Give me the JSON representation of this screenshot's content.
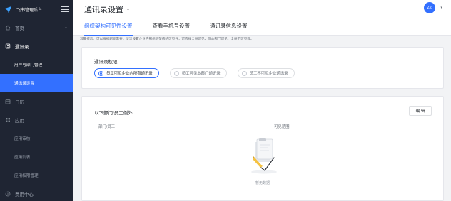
{
  "sidebar": {
    "brand_title": "飞书管理后台",
    "items": [
      {
        "label": "首页",
        "chevron": "▲"
      },
      {
        "label": "通讯录"
      },
      {
        "label": "用户与部门管理"
      },
      {
        "label": "通讯录设置"
      },
      {
        "label": "日历"
      },
      {
        "label": "应用"
      },
      {
        "label": "应用审核"
      },
      {
        "label": "应用列表"
      },
      {
        "label": "应用权限管理"
      },
      {
        "label": "费用中心"
      }
    ]
  },
  "header": {
    "title": "通讯录设置",
    "title_caret": "▾",
    "avatar_initials": "ZZ",
    "avatar_caret": "▾",
    "tabs": [
      {
        "label": "组织架构可见性设置"
      },
      {
        "label": "查看手机号设置"
      },
      {
        "label": "通讯录信息设置"
      }
    ]
  },
  "notice": "温馨提示：可以根据职能需要，灵活设置企业内部组织架构的可见性，可选择全员可见、仅本部门可见、全员不可见等。",
  "permission": {
    "title": "通讯录权限",
    "options": [
      {
        "label": "员工可见企业内所有通讯录",
        "checked": true
      },
      {
        "label": "员工可见本部门通讯录",
        "checked": false
      },
      {
        "label": "员工不可见企业通讯录",
        "checked": false
      }
    ]
  },
  "exceptions": {
    "title": "以下部门/员工例外",
    "edit_label": "编 辑",
    "columns": [
      "部门/员工",
      "可见范围"
    ],
    "empty_text": "暂无数据"
  },
  "colors": {
    "accent": "#3370ff",
    "sidebar_bg": "#1f2533",
    "page_bg": "#f2f3f5"
  }
}
